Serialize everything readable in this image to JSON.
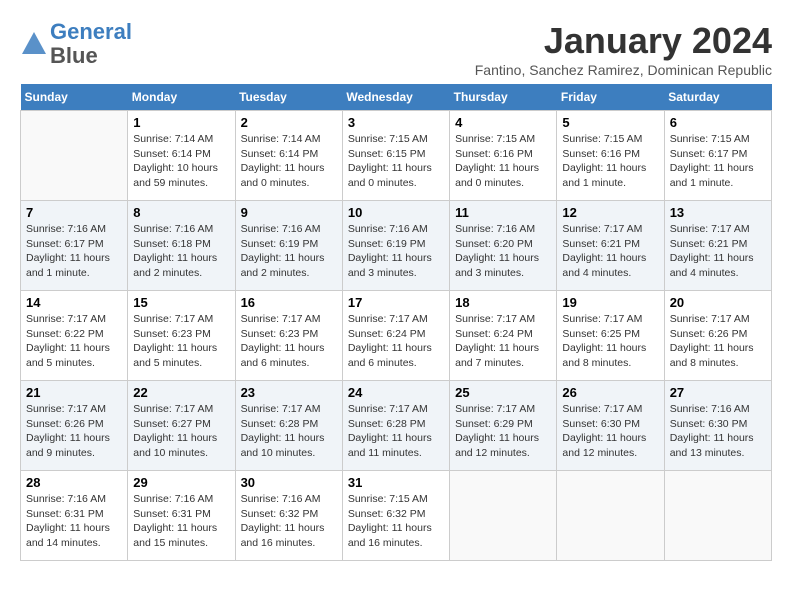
{
  "header": {
    "logo_line1": "General",
    "logo_line2": "Blue",
    "month_year": "January 2024",
    "location": "Fantino, Sanchez Ramirez, Dominican Republic"
  },
  "weekdays": [
    "Sunday",
    "Monday",
    "Tuesday",
    "Wednesday",
    "Thursday",
    "Friday",
    "Saturday"
  ],
  "weeks": [
    [
      {
        "day": "",
        "info": ""
      },
      {
        "day": "1",
        "info": "Sunrise: 7:14 AM\nSunset: 6:14 PM\nDaylight: 10 hours\nand 59 minutes."
      },
      {
        "day": "2",
        "info": "Sunrise: 7:14 AM\nSunset: 6:14 PM\nDaylight: 11 hours\nand 0 minutes."
      },
      {
        "day": "3",
        "info": "Sunrise: 7:15 AM\nSunset: 6:15 PM\nDaylight: 11 hours\nand 0 minutes."
      },
      {
        "day": "4",
        "info": "Sunrise: 7:15 AM\nSunset: 6:16 PM\nDaylight: 11 hours\nand 0 minutes."
      },
      {
        "day": "5",
        "info": "Sunrise: 7:15 AM\nSunset: 6:16 PM\nDaylight: 11 hours\nand 1 minute."
      },
      {
        "day": "6",
        "info": "Sunrise: 7:15 AM\nSunset: 6:17 PM\nDaylight: 11 hours\nand 1 minute."
      }
    ],
    [
      {
        "day": "7",
        "info": "Sunrise: 7:16 AM\nSunset: 6:17 PM\nDaylight: 11 hours\nand 1 minute."
      },
      {
        "day": "8",
        "info": "Sunrise: 7:16 AM\nSunset: 6:18 PM\nDaylight: 11 hours\nand 2 minutes."
      },
      {
        "day": "9",
        "info": "Sunrise: 7:16 AM\nSunset: 6:19 PM\nDaylight: 11 hours\nand 2 minutes."
      },
      {
        "day": "10",
        "info": "Sunrise: 7:16 AM\nSunset: 6:19 PM\nDaylight: 11 hours\nand 3 minutes."
      },
      {
        "day": "11",
        "info": "Sunrise: 7:16 AM\nSunset: 6:20 PM\nDaylight: 11 hours\nand 3 minutes."
      },
      {
        "day": "12",
        "info": "Sunrise: 7:17 AM\nSunset: 6:21 PM\nDaylight: 11 hours\nand 4 minutes."
      },
      {
        "day": "13",
        "info": "Sunrise: 7:17 AM\nSunset: 6:21 PM\nDaylight: 11 hours\nand 4 minutes."
      }
    ],
    [
      {
        "day": "14",
        "info": "Sunrise: 7:17 AM\nSunset: 6:22 PM\nDaylight: 11 hours\nand 5 minutes."
      },
      {
        "day": "15",
        "info": "Sunrise: 7:17 AM\nSunset: 6:23 PM\nDaylight: 11 hours\nand 5 minutes."
      },
      {
        "day": "16",
        "info": "Sunrise: 7:17 AM\nSunset: 6:23 PM\nDaylight: 11 hours\nand 6 minutes."
      },
      {
        "day": "17",
        "info": "Sunrise: 7:17 AM\nSunset: 6:24 PM\nDaylight: 11 hours\nand 6 minutes."
      },
      {
        "day": "18",
        "info": "Sunrise: 7:17 AM\nSunset: 6:24 PM\nDaylight: 11 hours\nand 7 minutes."
      },
      {
        "day": "19",
        "info": "Sunrise: 7:17 AM\nSunset: 6:25 PM\nDaylight: 11 hours\nand 8 minutes."
      },
      {
        "day": "20",
        "info": "Sunrise: 7:17 AM\nSunset: 6:26 PM\nDaylight: 11 hours\nand 8 minutes."
      }
    ],
    [
      {
        "day": "21",
        "info": "Sunrise: 7:17 AM\nSunset: 6:26 PM\nDaylight: 11 hours\nand 9 minutes."
      },
      {
        "day": "22",
        "info": "Sunrise: 7:17 AM\nSunset: 6:27 PM\nDaylight: 11 hours\nand 10 minutes."
      },
      {
        "day": "23",
        "info": "Sunrise: 7:17 AM\nSunset: 6:28 PM\nDaylight: 11 hours\nand 10 minutes."
      },
      {
        "day": "24",
        "info": "Sunrise: 7:17 AM\nSunset: 6:28 PM\nDaylight: 11 hours\nand 11 minutes."
      },
      {
        "day": "25",
        "info": "Sunrise: 7:17 AM\nSunset: 6:29 PM\nDaylight: 11 hours\nand 12 minutes."
      },
      {
        "day": "26",
        "info": "Sunrise: 7:17 AM\nSunset: 6:30 PM\nDaylight: 11 hours\nand 12 minutes."
      },
      {
        "day": "27",
        "info": "Sunrise: 7:16 AM\nSunset: 6:30 PM\nDaylight: 11 hours\nand 13 minutes."
      }
    ],
    [
      {
        "day": "28",
        "info": "Sunrise: 7:16 AM\nSunset: 6:31 PM\nDaylight: 11 hours\nand 14 minutes."
      },
      {
        "day": "29",
        "info": "Sunrise: 7:16 AM\nSunset: 6:31 PM\nDaylight: 11 hours\nand 15 minutes."
      },
      {
        "day": "30",
        "info": "Sunrise: 7:16 AM\nSunset: 6:32 PM\nDaylight: 11 hours\nand 16 minutes."
      },
      {
        "day": "31",
        "info": "Sunrise: 7:15 AM\nSunset: 6:32 PM\nDaylight: 11 hours\nand 16 minutes."
      },
      {
        "day": "",
        "info": ""
      },
      {
        "day": "",
        "info": ""
      },
      {
        "day": "",
        "info": ""
      }
    ]
  ]
}
